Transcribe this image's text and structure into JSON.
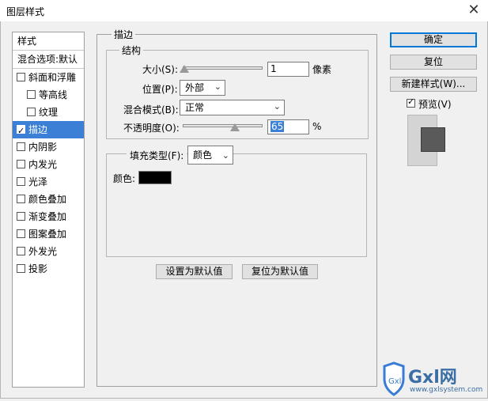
{
  "window": {
    "title": "图层样式",
    "close_glyph": "✕"
  },
  "sidebar": {
    "header": "样式",
    "blend_options": "混合选项:默认",
    "items": [
      {
        "label": "斜面和浮雕",
        "checked": false,
        "indent": false,
        "selected": false
      },
      {
        "label": "等高线",
        "checked": false,
        "indent": true,
        "selected": false
      },
      {
        "label": "纹理",
        "checked": false,
        "indent": true,
        "selected": false
      },
      {
        "label": "描边",
        "checked": true,
        "indent": false,
        "selected": true
      },
      {
        "label": "内阴影",
        "checked": false,
        "indent": false,
        "selected": false
      },
      {
        "label": "内发光",
        "checked": false,
        "indent": false,
        "selected": false
      },
      {
        "label": "光泽",
        "checked": false,
        "indent": false,
        "selected": false
      },
      {
        "label": "颜色叠加",
        "checked": false,
        "indent": false,
        "selected": false
      },
      {
        "label": "渐变叠加",
        "checked": false,
        "indent": false,
        "selected": false
      },
      {
        "label": "图案叠加",
        "checked": false,
        "indent": false,
        "selected": false
      },
      {
        "label": "外发光",
        "checked": false,
        "indent": false,
        "selected": false
      },
      {
        "label": "投影",
        "checked": false,
        "indent": false,
        "selected": false
      }
    ]
  },
  "stroke": {
    "group_title": "描边",
    "structure": {
      "title": "结构",
      "size_label": "大小(S):",
      "size_value": "1",
      "size_unit": "像素",
      "size_level": 0.02,
      "position_label": "位置(P):",
      "position_value": "外部",
      "blend_label": "混合模式(B):",
      "blend_value": "正常",
      "opacity_label": "不透明度(O):",
      "opacity_value": "65",
      "opacity_unit": "%",
      "opacity_level": 0.65
    },
    "fill": {
      "type_label": "填充类型(F):",
      "type_value": "颜色",
      "color_label": "颜色:",
      "color_value": "#000000"
    },
    "set_default": "设置为默认值",
    "reset_default": "复位为默认值"
  },
  "actions": {
    "ok": "确定",
    "reset": "复位",
    "new_style": "新建样式(W)...",
    "preview_label": "预览(V)",
    "preview_checked": true
  },
  "preview": {
    "swatch_color": "#5a5a5a"
  },
  "watermark": {
    "text": "Gxl网",
    "url": "www.gxlsystem.com"
  }
}
